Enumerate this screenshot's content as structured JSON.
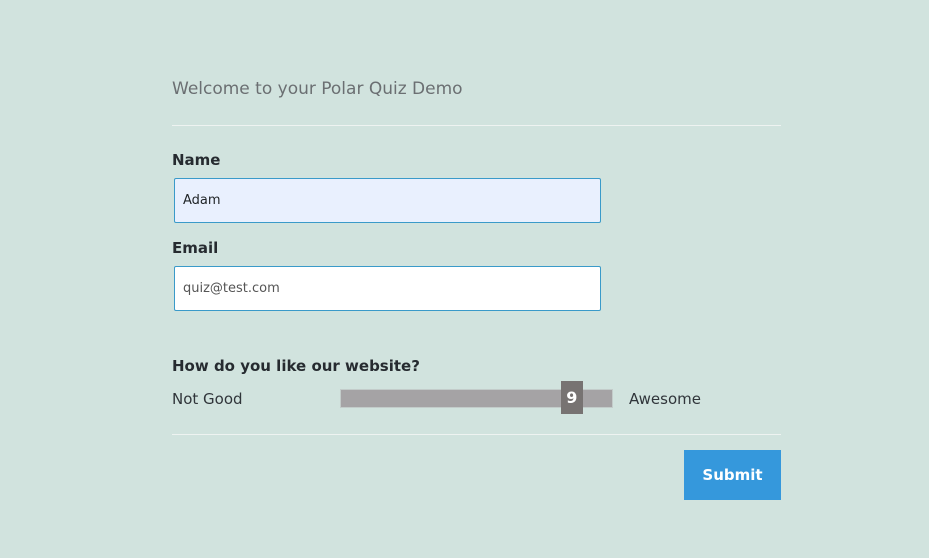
{
  "quiz": {
    "title": "Welcome to your Polar Quiz Demo",
    "name": {
      "label": "Name",
      "value": "Adam"
    },
    "email": {
      "label": "Email",
      "placeholder": "quiz@test.com",
      "value": ""
    },
    "rating": {
      "question": "How do you like our website?",
      "low_label": "Not Good",
      "high_label": "Awesome",
      "value": "9",
      "fraction": 0.88
    },
    "submit_label": "Submit"
  },
  "colors": {
    "background": "#d1e3de",
    "accent": "#3598dc",
    "field_border": "#3a9ac9",
    "slider_track": "#a5a3a5",
    "slider_thumb": "#777372"
  }
}
